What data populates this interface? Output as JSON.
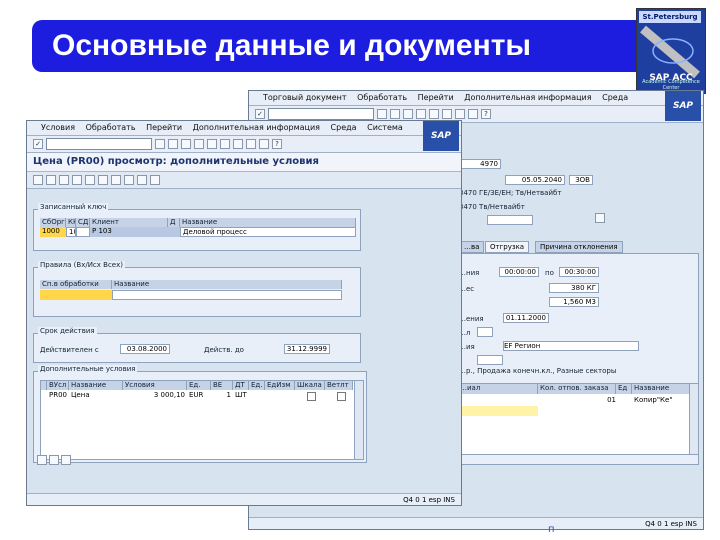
{
  "slide": {
    "title": "Основные данные и документы",
    "page_mark": "п"
  },
  "logo": {
    "top": "St.Petersburg",
    "brand": "SAP ACC",
    "sub": "Academic Competence Center"
  },
  "back_window": {
    "menu": [
      "Торговый документ",
      "Обработать",
      "Перейти",
      "Дополнительная информация",
      "Среда"
    ],
    "sap": "SAP",
    "header_fields": [
      "4970",
      "05.05.2040",
      "ЗОВ"
    ],
    "header_lines": [
      "3470 ГЕ/ЗЕ/ЕН; Тв/Нетвайбт",
      "3470 Тв/Нетвайбт"
    ],
    "tabs": [
      "…ва",
      "Отгрузка",
      "Причина отклонения"
    ],
    "rows": [
      {
        "label": "…ния",
        "v1": "00:00:00",
        "mid": "по",
        "v2": "00:30:00"
      },
      {
        "label": "…ес",
        "v2": "380 КГ"
      },
      {
        "label": "",
        "v2": "1,560 М3"
      },
      {
        "label": "…ения",
        "v1": "01.11.2000"
      },
      {
        "label": "…л"
      },
      {
        "label": "…ия",
        "v1": "EF Регион"
      }
    ],
    "sector_line": "…р., Продажа конечн.кл., Разные секторы",
    "table_headers": [
      "…иал",
      "Кол. отпов. заказа",
      "Ед",
      "Название"
    ],
    "table_row": [
      "",
      "01",
      "Копир\"Ке\""
    ],
    "status": "Q4 0 1   esp   INS"
  },
  "front_window": {
    "menu": [
      "Условия",
      "Обработать",
      "Перейти",
      "Дополнительная информация",
      "Среда",
      "Система"
    ],
    "sap": "SAP",
    "title": "Цена (PR00) просмотр: дополнительные условия",
    "group1": {
      "title": "Записанный ключ",
      "headers": [
        "СбОрг",
        "КК",
        "СД",
        "Клиент",
        "Д",
        "Название"
      ],
      "row": [
        "1000",
        "10",
        "",
        "Р 103",
        "",
        "Деловой процесс"
      ]
    },
    "group2": {
      "title": "Правила (Вх/Исх Всех)",
      "headers": [
        "Сп.в обработки",
        "Название"
      ],
      "row": [
        "",
        ""
      ]
    },
    "group3": {
      "title": "Срок действия",
      "valid_from_label": "Действителен с",
      "valid_from": "03.08.2000",
      "valid_to_label": "Действ. до",
      "valid_to": "31.12.9999"
    },
    "group4": {
      "title": "Дополнительные условия",
      "headers": [
        "ВУсл",
        "Название",
        "Условия",
        "Ед.",
        "ВЕ",
        "ДТ",
        "Ед.",
        "ЕдИзм",
        "Шкала",
        "Ветлт"
      ],
      "row": [
        "PR00",
        "Цена",
        "3 000,10",
        "EUR",
        "1",
        "ШТ",
        "",
        "",
        "",
        ""
      ]
    },
    "status": "Q4 0 1   esp   INS"
  }
}
